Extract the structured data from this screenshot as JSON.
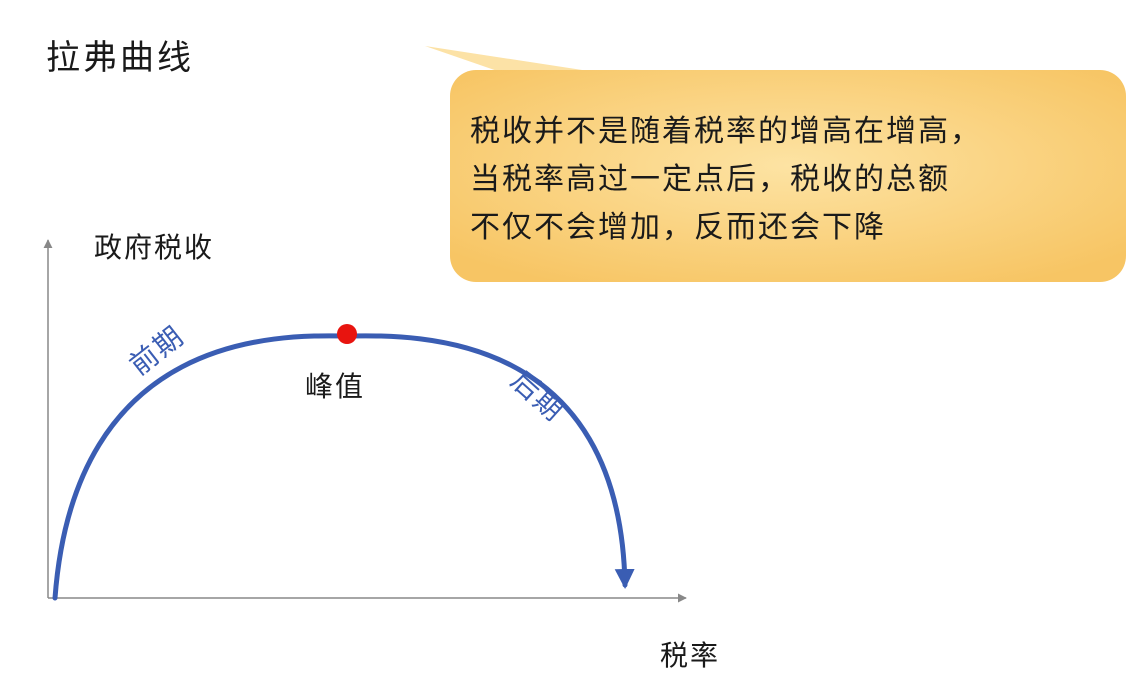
{
  "title": "拉弗曲线",
  "callout": {
    "lines": [
      "税收并不是随着税率的增高在增高，",
      "当税率高过一定点后，税收的总额",
      "不仅不会增加，反而还会下降"
    ]
  },
  "axes": {
    "y_label": "政府税收",
    "x_label": "税率"
  },
  "curve": {
    "early_label": "前期",
    "peak_label": "峰值",
    "late_label": "后期",
    "curve_color": "#3a5db3",
    "peak_color": "#e8140f"
  },
  "colors": {
    "callout_fill": "#fcd98c",
    "callout_fill_edge": "#f8c96a",
    "axis": "#888888"
  }
}
